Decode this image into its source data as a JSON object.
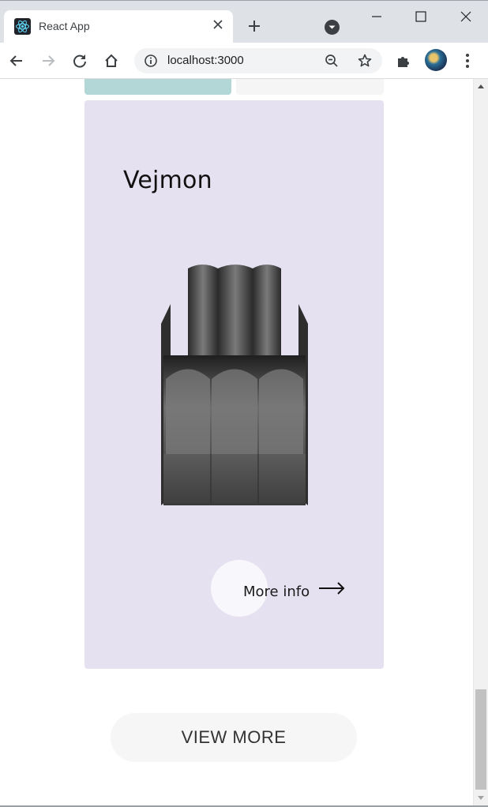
{
  "browser": {
    "tab": {
      "title": "React App",
      "favicon": "react-logo-icon"
    },
    "toolbar": {
      "url": "localhost:3000",
      "icons": [
        "back-icon",
        "forward-icon",
        "reload-icon",
        "home-icon",
        "site-info-icon",
        "zoom-icon",
        "bookmark-star-icon",
        "extensions-icon",
        "profile-avatar",
        "menu-icon"
      ]
    },
    "window_controls": [
      "minimize-icon",
      "maximize-icon",
      "close-icon"
    ]
  },
  "page": {
    "product": {
      "name": "Vejmon",
      "more_info_label": "More info",
      "card_color": "#e5e1f0"
    },
    "view_more_label": "VIEW MORE",
    "colors": {
      "prev_card_left": "#b3d7d7",
      "prev_card_right": "#f5f5f5"
    }
  }
}
